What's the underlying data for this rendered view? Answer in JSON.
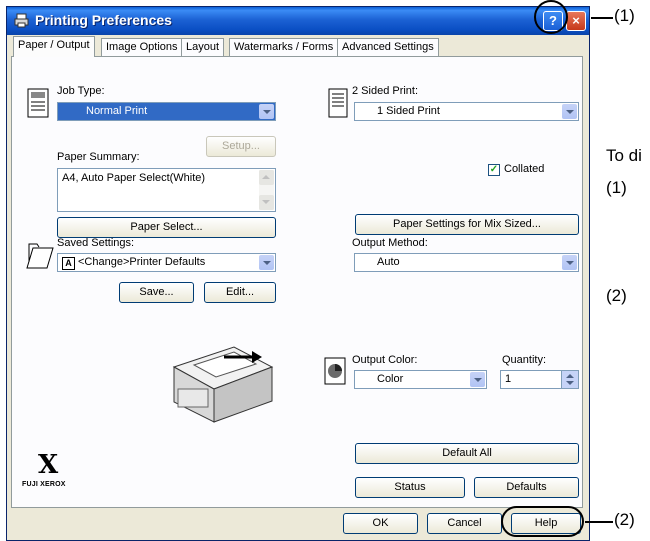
{
  "window": {
    "title": "Printing Preferences",
    "help_button": "?",
    "close_button": "×"
  },
  "tabs": [
    {
      "label": "Paper / Output",
      "active": true
    },
    {
      "label": "Image Options"
    },
    {
      "label": "Layout"
    },
    {
      "label": "Watermarks / Forms"
    },
    {
      "label": "Advanced Settings"
    }
  ],
  "job_type": {
    "label": "Job Type:",
    "value": "Normal Print",
    "setup_button": "Setup..."
  },
  "paper_summary": {
    "label": "Paper Summary:",
    "value": "A4, Auto Paper Select(White)",
    "paper_select_button": "Paper Select..."
  },
  "saved_settings": {
    "label": "Saved Settings:",
    "value": "<Change>Printer Defaults",
    "badge": "A",
    "save_button": "Save...",
    "edit_button": "Edit..."
  },
  "two_sided": {
    "label": "2 Sided Print:",
    "value": "1 Sided Print"
  },
  "collated": {
    "label": "Collated",
    "checked": true
  },
  "mix_sized_button": "Paper Settings for Mix Sized...",
  "output_method": {
    "label": "Output Method:",
    "value": "Auto"
  },
  "output_color": {
    "label": "Output Color:",
    "value": "Color"
  },
  "quantity": {
    "label": "Quantity:",
    "value": "1"
  },
  "buttons": {
    "default_all": "Default All",
    "status": "Status",
    "defaults": "Defaults",
    "ok": "OK",
    "cancel": "Cancel",
    "help": "Help"
  },
  "brand": {
    "text": "FUJI XEROX",
    "mark": "X"
  },
  "callouts": [
    {
      "label": "(1)"
    },
    {
      "label": "(2)"
    }
  ],
  "side_text": {
    "intro": "To di",
    "item1": "(1)",
    "item2": "(2)"
  }
}
